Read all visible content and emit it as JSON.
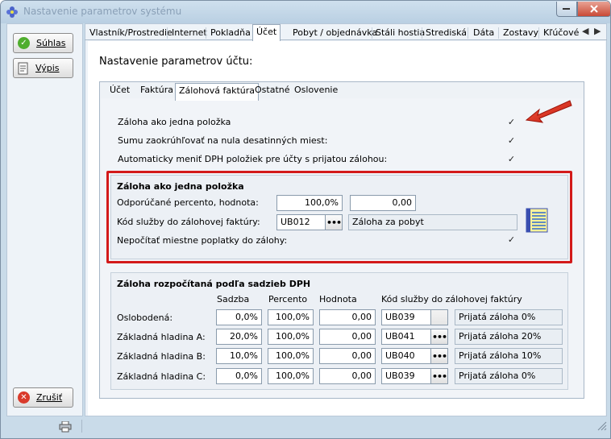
{
  "window": {
    "title": "Nastavenie parametrov systému"
  },
  "sidebar": {
    "buttons": [
      {
        "label": "Súhlas",
        "icon": "check-icon"
      },
      {
        "label": "Výpis",
        "icon": "document-icon"
      },
      {
        "label": "Zrušiť",
        "icon": "cancel-icon"
      }
    ]
  },
  "top_tabs": [
    {
      "label": "Vlastník/Prostredie"
    },
    {
      "label": "Internet"
    },
    {
      "label": "Pokladňa"
    },
    {
      "label": "Účet",
      "active": true
    },
    {
      "label": "Pobyt / objednávka"
    },
    {
      "label": "Stáli hostia"
    },
    {
      "label": "Strediská"
    },
    {
      "label": "Dáta"
    },
    {
      "label": "Zostavy"
    },
    {
      "label": "Kľúčové"
    }
  ],
  "page": {
    "title": "Nastavenie parametrov účtu:"
  },
  "sub_tabs": [
    {
      "label": "Účet"
    },
    {
      "label": "Faktúra"
    },
    {
      "label": "Zálohová faktúra",
      "active": true
    },
    {
      "label": "Ostatné"
    },
    {
      "label": "Oslovenie"
    }
  ],
  "options": [
    {
      "label": "Záloha ako jedna položka",
      "checked": true
    },
    {
      "label": "Sumu zaokrúhľovať na nula desatinných miest:",
      "checked": true
    },
    {
      "label": "Automaticky meniť DPH položiek pre účty s prijatou zálohou:",
      "checked": true
    }
  ],
  "single_group": {
    "title": "Záloha ako jedna položka",
    "percent_label": "Odporúčané percento, hodnota:",
    "percent_value": "100,0%",
    "amount_value": "0,00",
    "service_label": "Kód služby do zálohovej faktúry:",
    "service_code": "UB012",
    "service_name": "Záloha za pobyt",
    "fees_label": "Nepočítať miestne poplatky do zálohy:",
    "fees_checked": true
  },
  "vat_group": {
    "title": "Záloha rozpočítaná podľa sadzieb DPH",
    "columns": [
      "Sadzba",
      "Percento",
      "Hodnota",
      "Kód služby do zálohovej faktúry"
    ],
    "rows": [
      {
        "label": "Oslobodená:",
        "rate": "0,0%",
        "percent": "100,0%",
        "amount": "0,00",
        "code": "UB039",
        "name": "Prijatá záloha 0%",
        "button_enabled": false
      },
      {
        "label": "Základná hladina A:",
        "rate": "20,0%",
        "percent": "100,0%",
        "amount": "0,00",
        "code": "UB041",
        "name": "Prijatá záloha 20%",
        "button_enabled": true
      },
      {
        "label": "Základná hladina B:",
        "rate": "10,0%",
        "percent": "100,0%",
        "amount": "0,00",
        "code": "UB040",
        "name": "Prijatá záloha 10%",
        "button_enabled": true
      },
      {
        "label": "Základná hladina C:",
        "rate": "0,0%",
        "percent": "100,0%",
        "amount": "0,00",
        "code": "UB039",
        "name": "Prijatá záloha 0%",
        "button_enabled": true
      }
    ]
  },
  "colors": {
    "highlight_box": "#d31a1a",
    "arrow": "#e0241a"
  }
}
